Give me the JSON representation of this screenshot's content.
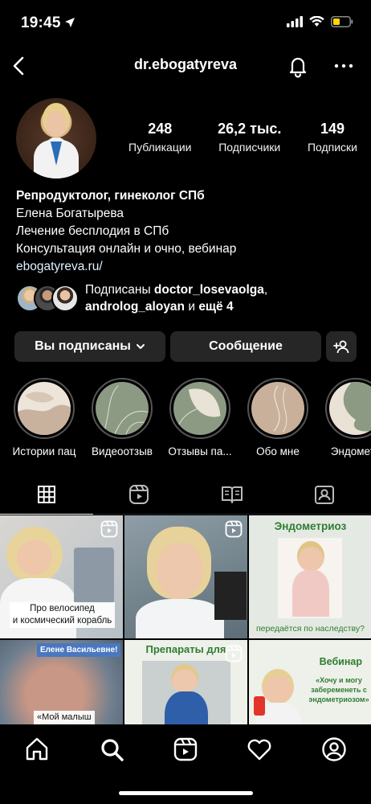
{
  "status": {
    "time": "19:45"
  },
  "nav": {
    "username": "dr.ebogatyreva"
  },
  "stats": [
    {
      "num": "248",
      "label": "Публикации"
    },
    {
      "num": "26,2 тыс.",
      "label": "Подписчики"
    },
    {
      "num": "149",
      "label": "Подписки"
    }
  ],
  "bio": {
    "headline": "Репродуктолог, гинеколог СПб",
    "lines": [
      "Елена Богатырева",
      "Лечение бесплодия в СПб",
      "Консультация онлайн и очно, вебинар"
    ],
    "link": "ebogatyreva.ru/"
  },
  "followed_by": {
    "prefix": "Подписаны ",
    "user1": "doctor_losevaolga",
    "sep": ",",
    "user2": "androlog_aloyan",
    "middle": " и ",
    "suffix": "ещё 4"
  },
  "actions": {
    "following": "Вы подписаны",
    "message": "Сообщение"
  },
  "highlights": [
    {
      "label": "Истории пац"
    },
    {
      "label": "Видеоотзыв"
    },
    {
      "label": "Отзывы па..."
    },
    {
      "label": "Обо мне"
    },
    {
      "label": "Эндометр"
    }
  ],
  "grid": {
    "cell1": {
      "caption": "Про велосипед\nи космический корабль"
    },
    "cell3": {
      "title": "Эндометриоз",
      "caption": "передаётся по наследству?"
    },
    "cell4": {
      "top": "Елене Васильевне!",
      "caption": "«Мой малыш"
    },
    "cell5": {
      "title": "Препараты для"
    },
    "cell6": {
      "title": "Вебинар",
      "caption": "«Хочу и могу забеременеть с эндометриозом»"
    }
  },
  "colors": {
    "accent_green": "#2e7d32",
    "button_bg": "#262626",
    "background": "#000000"
  }
}
